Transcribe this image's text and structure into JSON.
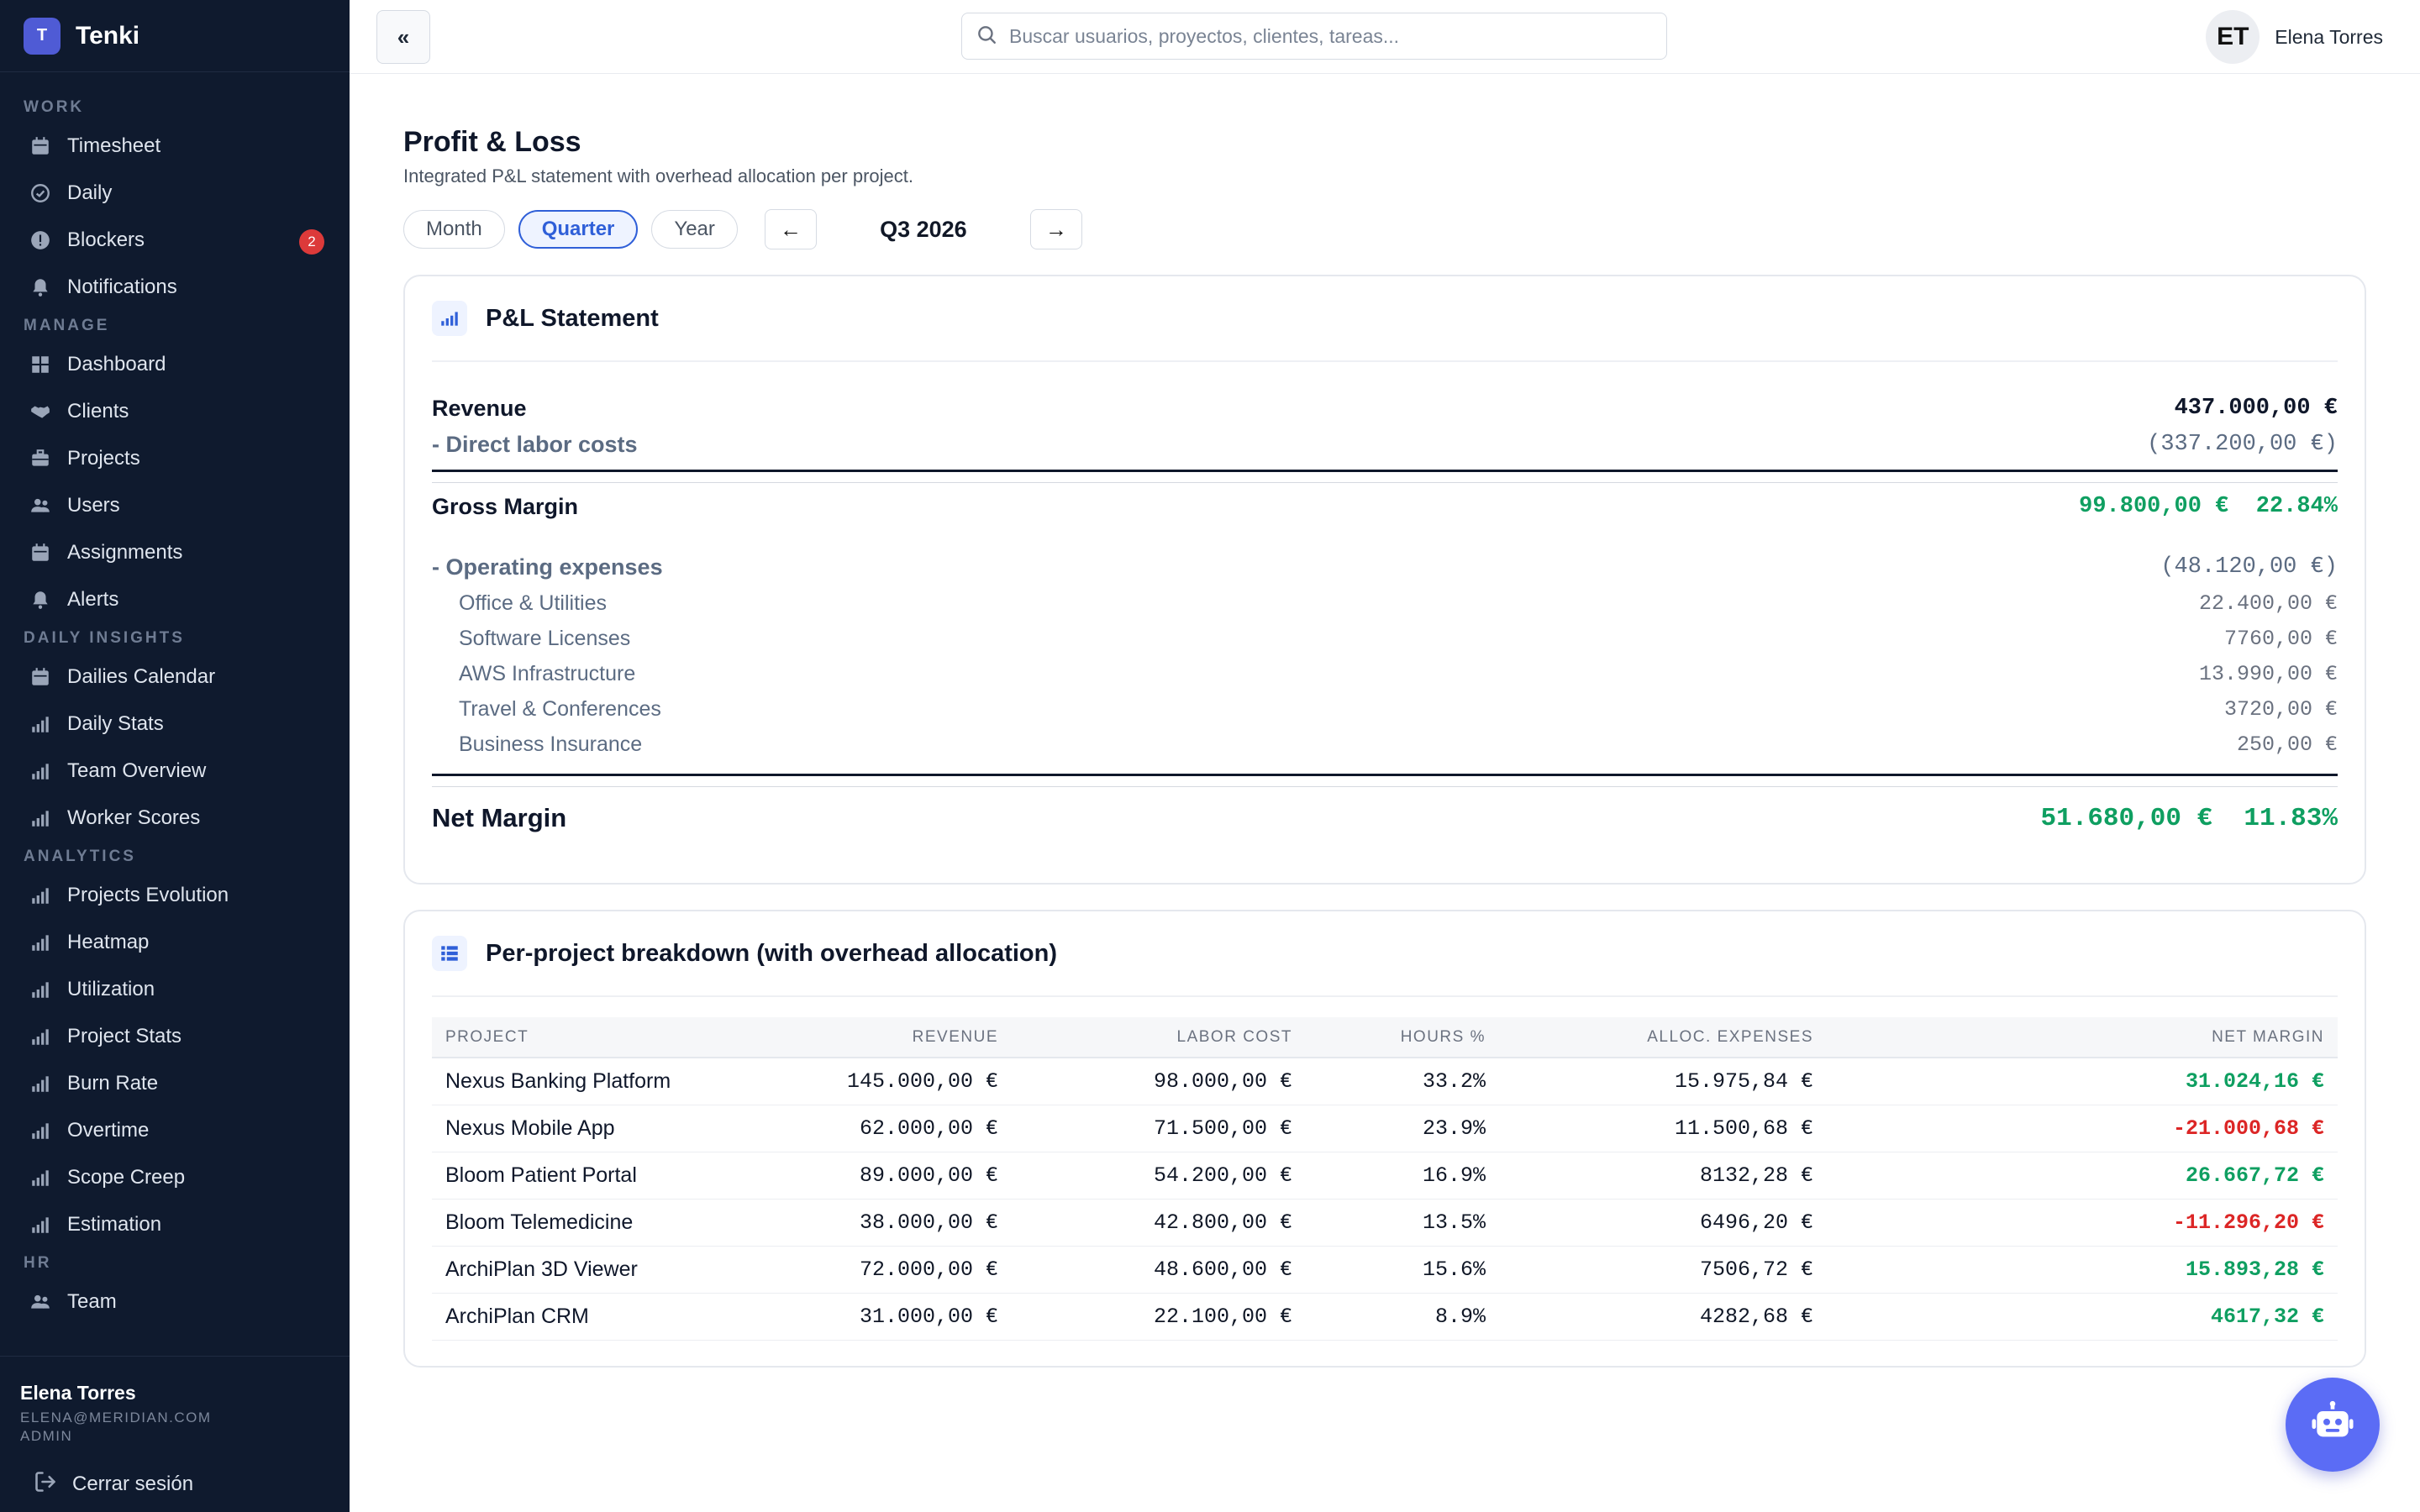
{
  "app": {
    "logo_letter": "T",
    "name": "Tenki"
  },
  "sidebar": {
    "sections": [
      {
        "title": "WORK",
        "items": [
          {
            "label": "Timesheet",
            "icon": "calendar-icon"
          },
          {
            "label": "Daily",
            "icon": "check-circle-icon"
          },
          {
            "label": "Blockers",
            "icon": "alert-circle-icon",
            "badge": "2"
          },
          {
            "label": "Notifications",
            "icon": "bell-icon"
          }
        ]
      },
      {
        "title": "MANAGE",
        "items": [
          {
            "label": "Dashboard",
            "icon": "grid-icon"
          },
          {
            "label": "Clients",
            "icon": "handshake-icon"
          },
          {
            "label": "Projects",
            "icon": "briefcase-icon"
          },
          {
            "label": "Users",
            "icon": "users-icon"
          },
          {
            "label": "Assignments",
            "icon": "calendar-icon"
          },
          {
            "label": "Alerts",
            "icon": "bell-icon"
          }
        ]
      },
      {
        "title": "DAILY INSIGHTS",
        "items": [
          {
            "label": "Dailies Calendar",
            "icon": "calendar-icon"
          },
          {
            "label": "Daily Stats",
            "icon": "bar-chart-icon"
          },
          {
            "label": "Team Overview",
            "icon": "bar-chart-icon"
          },
          {
            "label": "Worker Scores",
            "icon": "bar-chart-icon"
          }
        ]
      },
      {
        "title": "ANALYTICS",
        "items": [
          {
            "label": "Projects Evolution",
            "icon": "bar-chart-icon"
          },
          {
            "label": "Heatmap",
            "icon": "bar-chart-icon"
          },
          {
            "label": "Utilization",
            "icon": "bar-chart-icon"
          },
          {
            "label": "Project Stats",
            "icon": "bar-chart-icon"
          },
          {
            "label": "Burn Rate",
            "icon": "bar-chart-icon"
          },
          {
            "label": "Overtime",
            "icon": "bar-chart-icon"
          },
          {
            "label": "Scope Creep",
            "icon": "bar-chart-icon"
          },
          {
            "label": "Estimation",
            "icon": "bar-chart-icon"
          }
        ]
      },
      {
        "title": "HR",
        "items": [
          {
            "label": "Team",
            "icon": "users-icon"
          }
        ]
      }
    ],
    "footer": {
      "name": "Elena Torres",
      "email": "ELENA@MERIDIAN.COM",
      "role": "ADMIN",
      "logout_label": "Cerrar sesión"
    }
  },
  "topbar": {
    "collapse_icon": "«",
    "search_placeholder": "Buscar usuarios, proyectos, clientes, tareas...",
    "user_initials": "ET",
    "user_name": "Elena Torres"
  },
  "page": {
    "title": "Profit & Loss",
    "subtitle": "Integrated P&L statement with overhead allocation per project.",
    "period_tabs": [
      "Month",
      "Quarter",
      "Year"
    ],
    "active_tab": "Quarter",
    "prev_arrow": "←",
    "next_arrow": "→",
    "period_label": "Q3 2026"
  },
  "pl": {
    "title": "P&L Statement",
    "revenue_label": "Revenue",
    "revenue_value": "437.000,00 €",
    "labor_label": "- Direct labor costs",
    "labor_value": "(337.200,00 €)",
    "gross_label": "Gross Margin",
    "gross_value": "99.800,00 €",
    "gross_pct": "22.84%",
    "opex_label": "- Operating expenses",
    "opex_value": "(48.120,00 €)",
    "opex_items": [
      {
        "label": "Office & Utilities",
        "value": "22.400,00 €"
      },
      {
        "label": "Software Licenses",
        "value": "7760,00 €"
      },
      {
        "label": "AWS Infrastructure",
        "value": "13.990,00 €"
      },
      {
        "label": "Travel & Conferences",
        "value": "3720,00 €"
      },
      {
        "label": "Business Insurance",
        "value": "250,00 €"
      }
    ],
    "net_label": "Net Margin",
    "net_value": "51.680,00 €",
    "net_pct": "11.83%"
  },
  "breakdown": {
    "title": "Per-project breakdown (with overhead allocation)",
    "columns": [
      "PROJECT",
      "REVENUE",
      "LABOR COST",
      "HOURS %",
      "ALLOC. EXPENSES",
      "NET MARGIN"
    ],
    "rows": [
      {
        "project": "Nexus Banking Platform",
        "revenue": "145.000,00 €",
        "labor": "98.000,00 €",
        "hours": "33.2%",
        "alloc": "15.975,84 €",
        "net": "31.024,16 €",
        "positive": true
      },
      {
        "project": "Nexus Mobile App",
        "revenue": "62.000,00 €",
        "labor": "71.500,00 €",
        "hours": "23.9%",
        "alloc": "11.500,68 €",
        "net": "-21.000,68 €",
        "positive": false
      },
      {
        "project": "Bloom Patient Portal",
        "revenue": "89.000,00 €",
        "labor": "54.200,00 €",
        "hours": "16.9%",
        "alloc": "8132,28 €",
        "net": "26.667,72 €",
        "positive": true
      },
      {
        "project": "Bloom Telemedicine",
        "revenue": "38.000,00 €",
        "labor": "42.800,00 €",
        "hours": "13.5%",
        "alloc": "6496,20 €",
        "net": "-11.296,20 €",
        "positive": false
      },
      {
        "project": "ArchiPlan 3D Viewer",
        "revenue": "72.000,00 €",
        "labor": "48.600,00 €",
        "hours": "15.6%",
        "alloc": "7506,72 €",
        "net": "15.893,28 €",
        "positive": true
      },
      {
        "project": "ArchiPlan CRM",
        "revenue": "31.000,00 €",
        "labor": "22.100,00 €",
        "hours": "8.9%",
        "alloc": "4282,68 €",
        "net": "4617,32 €",
        "positive": true
      }
    ]
  },
  "colors": {
    "sidebar_bg": "#0f1a2e",
    "accent": "#2f5fd8",
    "positive": "#0f9f61",
    "negative": "#dc2626",
    "fab": "#5b6cf5"
  },
  "fab_icon": "robot-icon"
}
